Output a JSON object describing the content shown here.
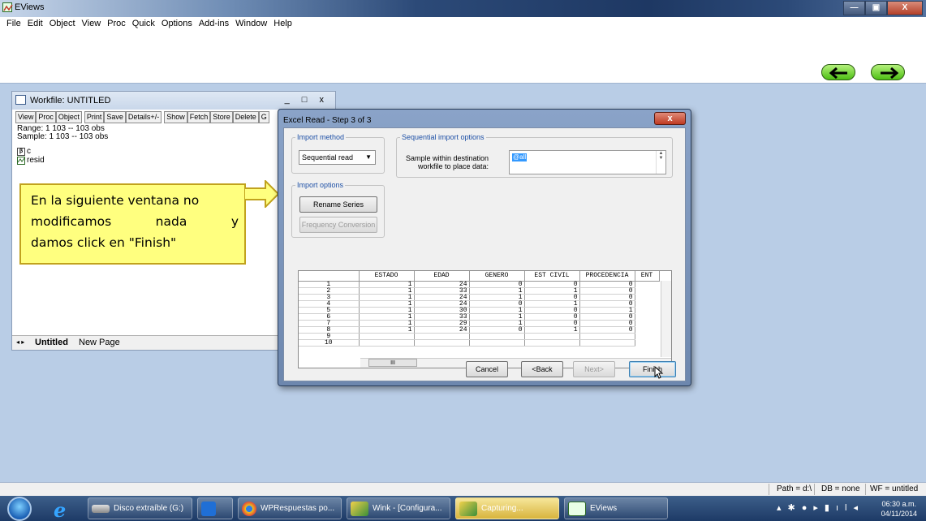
{
  "app": {
    "title": "EViews"
  },
  "menu": [
    "File",
    "Edit",
    "Object",
    "View",
    "Proc",
    "Quick",
    "Options",
    "Add-ins",
    "Window",
    "Help"
  ],
  "workfile": {
    "title": "Workfile: UNTITLED",
    "controls": "_ □ x",
    "toolbar_group1": [
      "View",
      "Proc",
      "Object"
    ],
    "toolbar_group2": [
      "Print",
      "Save",
      "Details+/-"
    ],
    "toolbar_group3": [
      "Show",
      "Fetch",
      "Store",
      "Delete",
      "G"
    ],
    "range": "Range:  1 103  --  103 obs",
    "sample": "Sample: 1 103  --  103 obs",
    "objects": [
      {
        "icon": "beta",
        "name": "c"
      },
      {
        "icon": "series",
        "name": "resid"
      }
    ],
    "tabs": [
      "Untitled",
      "New Page"
    ]
  },
  "dialog": {
    "title": "Excel Read - Step 3 of 3",
    "close_label": "x",
    "import_method_legend": "Import method",
    "import_method_value": "Sequential read",
    "seq_options_legend": "Sequential import options",
    "sample_label_1": "Sample within destination",
    "sample_label_2": "workfile to place data:",
    "sample_value": "@all",
    "import_options_legend": "Import options",
    "rename_series": "Rename Series",
    "frequency_conversion": "Frequency Conversion",
    "buttons": {
      "cancel": "Cancel",
      "back": "<Back",
      "next": "Next>",
      "finish": "Finish"
    }
  },
  "preview": {
    "columns": [
      "ESTADO",
      "EDAD",
      "GENERO",
      "EST CIVIL",
      "PROCEDENCIA",
      "ENT"
    ],
    "rows": [
      [
        "1",
        "1",
        "24",
        "0",
        "0",
        "0"
      ],
      [
        "2",
        "1",
        "33",
        "1",
        "1",
        "0"
      ],
      [
        "3",
        "1",
        "24",
        "1",
        "0",
        "0"
      ],
      [
        "4",
        "1",
        "24",
        "0",
        "1",
        "0"
      ],
      [
        "5",
        "1",
        "30",
        "1",
        "0",
        "1"
      ],
      [
        "6",
        "1",
        "33",
        "1",
        "0",
        "0"
      ],
      [
        "7",
        "1",
        "29",
        "1",
        "0",
        "0"
      ],
      [
        "8",
        "1",
        "24",
        "0",
        "1",
        "0"
      ],
      [
        "9",
        "",
        "",
        "",
        "",
        ""
      ],
      [
        "10",
        "",
        "",
        "",
        "",
        ""
      ]
    ],
    "hscroll_thumb": "III"
  },
  "callout": {
    "line1": "En la siguiente ventana no",
    "line2a": "modificamos",
    "line2b": "nada",
    "line2c": "y",
    "line3": "damos click en \"Finish\""
  },
  "statusbar": {
    "path": "Path = d:\\",
    "db": "DB = none",
    "wf": "WF = untitled"
  },
  "taskbar": {
    "items": [
      "Disco extraíble (G:)",
      "WPRespuestas po...",
      "Wink - [Configura...",
      "Capturing...",
      "EViews"
    ],
    "time": "06:30 a.m.",
    "date": "04/11/2014"
  },
  "colors": {
    "callout_bg": "#ffff7f",
    "accent_blue": "#1e50a6",
    "nav_green": "#4dbf13"
  }
}
